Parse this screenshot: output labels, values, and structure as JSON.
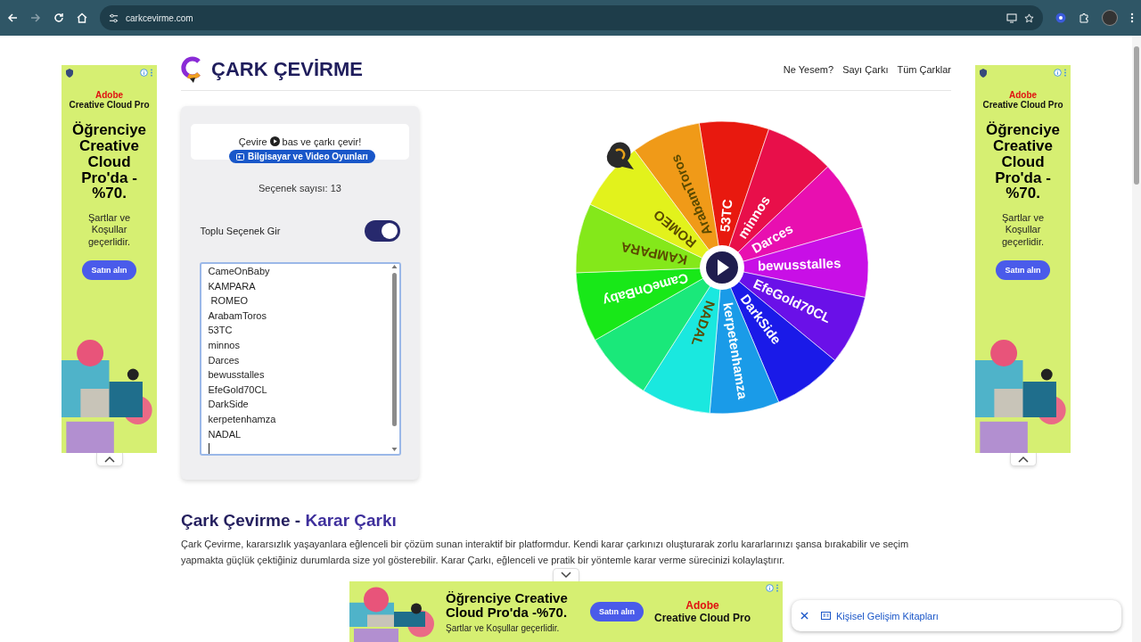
{
  "browser": {
    "url": "carkcevirme.com"
  },
  "site": {
    "logo_text": "ÇARK ÇEVİRME",
    "nav": [
      "Ne Yesem?",
      "Sayı Çarkı",
      "Tüm Çarklar"
    ]
  },
  "panel": {
    "hint_before": "Çevire",
    "hint_after": "bas ve çarkı çevir!",
    "category": "Bilgisayar ve Video Oyunları",
    "count": "Seçenek sayısı: 13",
    "bulk_toggle": {
      "label": "Toplu Seçenek Gir",
      "on": true
    },
    "options": [
      "CameOnBaby",
      "KAMPARA",
      " ROMEO",
      "ArabamToros",
      "53TC",
      "minnos",
      "Darces",
      "bewusstalles",
      "EfeGold70CL",
      "DarkSide",
      "kerpetenhamza",
      "NADAL"
    ]
  },
  "wheel": {
    "segments": [
      {
        "label": "53TC",
        "color": "#e8190f"
      },
      {
        "label": "minnos",
        "color": "#e80f4a"
      },
      {
        "label": "Darces",
        "color": "#e80fb0"
      },
      {
        "label": "bewusstalles",
        "color": "#c80fe6"
      },
      {
        "label": "EfeGold70CL",
        "color": "#6a10e8"
      },
      {
        "label": "DarkSide",
        "color": "#1a1ae8"
      },
      {
        "label": "kerpetenhamza",
        "color": "#1a9be8"
      },
      {
        "label": "NADAL",
        "color": "#1ae8df"
      },
      {
        "color": "#1ae87a"
      },
      {
        "label": "CameOnBaby",
        "color": "#18e818"
      },
      {
        "label": "KAMPARA",
        "color": "#84e81a"
      },
      {
        "label": "ROMEO",
        "color": "#e2f21c"
      },
      {
        "label": "ArabamToros",
        "color": "#f09a18"
      }
    ]
  },
  "article": {
    "title_parts": [
      "Çark Çevirme -",
      "Karar Çarkı"
    ],
    "paragraph": "Çark Çevirme, kararsızlık yaşayanlara eğlenceli bir çözüm sunan interaktif bir platformdur. Kendi karar çarkınızı oluşturarak zorlu kararlarınızı şansa bırakabilir ve seçim yapmakta güçlük çektiğiniz durumlarda size yol gösterebilir. Karar Çarkı, eğlenceli ve pratik bir yöntemle karar verme sürecinizi kolaylaştırır."
  },
  "ads": [
    {
      "kind": "vertical",
      "brand": "Adobe",
      "product": "Creative Cloud Pro",
      "headline": "Öğrenciye Creative Cloud Pro'da -%70.",
      "terms": "Şartlar ve Koşullar geçerlidir.",
      "button": "Satın alın"
    },
    {
      "kind": "vertical",
      "brand": "Adobe",
      "product": "Creative Cloud Pro",
      "headline": "Öğrenciye Creative Cloud Pro'da -%70.",
      "terms": "Şartlar ve Koşullar geçerlidir.",
      "button": "Satın alın"
    },
    {
      "kind": "horizontal",
      "brand": "Adobe",
      "product": "Creative Cloud Pro",
      "headline": "Öğrenciye Creative Cloud Pro'da -%70.",
      "terms": "Şartlar ve Koşullar geçerlidir.",
      "button": "Satın alın"
    }
  ],
  "notification": {
    "text": "Kişisel Gelişim Kitapları"
  }
}
